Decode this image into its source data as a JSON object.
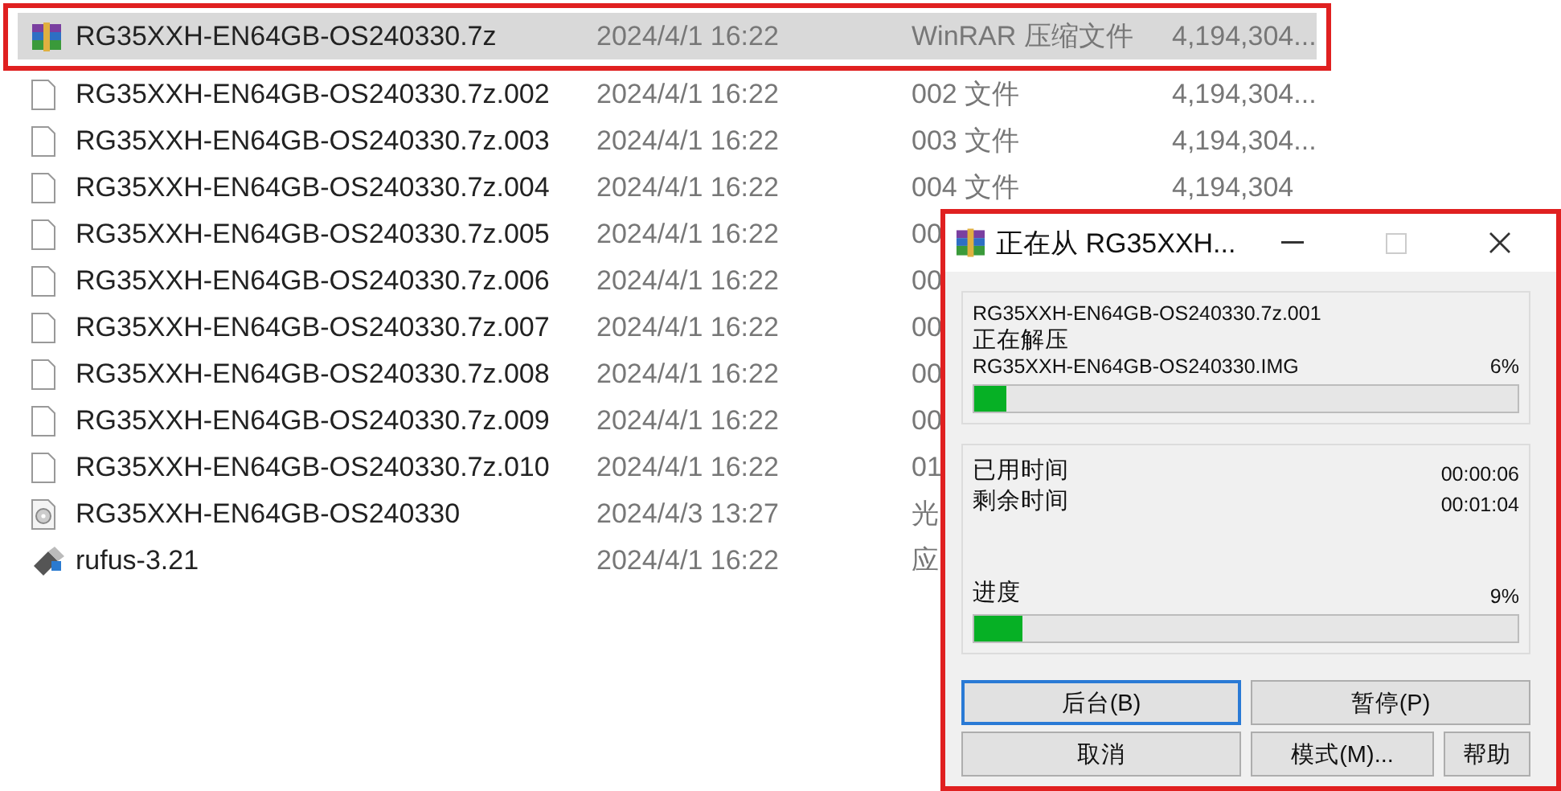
{
  "files": [
    {
      "kind": "archive",
      "name": "RG35XXH-EN64GB-OS240330.7z",
      "date": "2024/4/1 16:22",
      "type": "WinRAR 压缩文件",
      "size": "4,194,304...",
      "selected": true,
      "highlighted": true
    },
    {
      "kind": "file",
      "name": "RG35XXH-EN64GB-OS240330.7z.002",
      "date": "2024/4/1 16:22",
      "type": "002 文件",
      "size": "4,194,304...",
      "selected": false,
      "highlighted": false
    },
    {
      "kind": "file",
      "name": "RG35XXH-EN64GB-OS240330.7z.003",
      "date": "2024/4/1 16:22",
      "type": "003 文件",
      "size": "4,194,304...",
      "selected": false,
      "highlighted": false
    },
    {
      "kind": "file",
      "name": "RG35XXH-EN64GB-OS240330.7z.004",
      "date": "2024/4/1 16:22",
      "type": "004 文件",
      "size": "4,194,304",
      "selected": false,
      "highlighted": false
    },
    {
      "kind": "file",
      "name": "RG35XXH-EN64GB-OS240330.7z.005",
      "date": "2024/4/1 16:22",
      "type": "00",
      "selected": false,
      "highlighted": false
    },
    {
      "kind": "file",
      "name": "RG35XXH-EN64GB-OS240330.7z.006",
      "date": "2024/4/1 16:22",
      "type": "00",
      "selected": false,
      "highlighted": false
    },
    {
      "kind": "file",
      "name": "RG35XXH-EN64GB-OS240330.7z.007",
      "date": "2024/4/1 16:22",
      "type": "00",
      "selected": false,
      "highlighted": false
    },
    {
      "kind": "file",
      "name": "RG35XXH-EN64GB-OS240330.7z.008",
      "date": "2024/4/1 16:22",
      "type": "00",
      "selected": false,
      "highlighted": false
    },
    {
      "kind": "file",
      "name": "RG35XXH-EN64GB-OS240330.7z.009",
      "date": "2024/4/1 16:22",
      "type": "00",
      "selected": false,
      "highlighted": false
    },
    {
      "kind": "file",
      "name": "RG35XXH-EN64GB-OS240330.7z.010",
      "date": "2024/4/1 16:22",
      "type": "01",
      "selected": false,
      "highlighted": false
    },
    {
      "kind": "disc",
      "name": "RG35XXH-EN64GB-OS240330",
      "date": "2024/4/3 13:27",
      "type": "光",
      "selected": false,
      "highlighted": false
    },
    {
      "kind": "app",
      "name": "rufus-3.21",
      "date": "2024/4/1 16:22",
      "type": "应",
      "selected": false,
      "highlighted": false
    }
  ],
  "dialog": {
    "title": "正在从 RG35XXH...",
    "highlighted": true,
    "archive": "RG35XXH-EN64GB-OS240330.7z.001",
    "status": "正在解压",
    "current_file": "RG35XXH-EN64GB-OS240330.IMG",
    "file_percent": "6%",
    "file_progress": {
      "level": 0.06
    },
    "elapsed_label": "已用时间",
    "elapsed": "00:00:06",
    "remaining_label": "剩余时间",
    "remaining": "00:01:04",
    "progress_label": "进度",
    "total_percent": "9%",
    "total_progress": {
      "level": 0.09
    },
    "buttons": [
      {
        "label": "后台(B)",
        "focused": true
      },
      {
        "label": "暂停(P)",
        "focused": false
      },
      {
        "label": "取消",
        "focused": false
      },
      {
        "label": "模式(M)...",
        "focused": false
      },
      {
        "label": "帮助",
        "focused": false
      }
    ]
  }
}
